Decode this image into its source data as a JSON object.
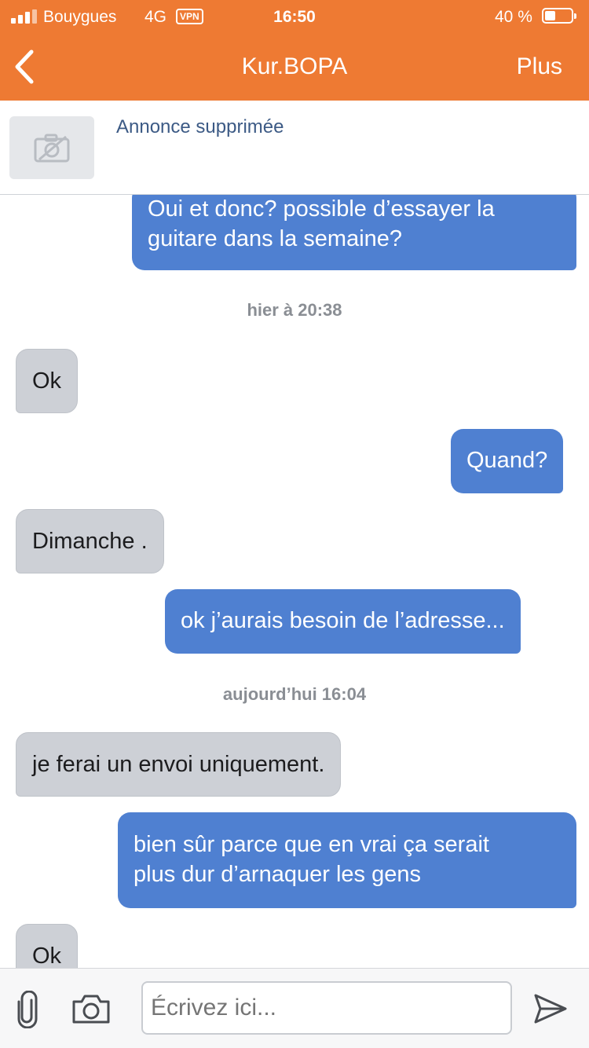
{
  "status_bar": {
    "carrier": "Bouygues",
    "network": "4G",
    "vpn": "VPN",
    "time": "16:50",
    "battery_pct": "40 %",
    "battery_level": 0.4
  },
  "nav": {
    "title": "Kur.BOPA",
    "more": "Plus",
    "accent": "#ee7a33"
  },
  "listing": {
    "title": "Annonce supprimée"
  },
  "messages": [
    {
      "type": "out",
      "text_lines": [
        "Oui et donc? possible d’essayer la",
        "guitare dans la semaine?"
      ]
    },
    {
      "type": "stamp",
      "text": "hier à 20:38"
    },
    {
      "type": "in",
      "text": "Ok"
    },
    {
      "type": "out",
      "text": "Quand?"
    },
    {
      "type": "in",
      "text": "Dimanche ."
    },
    {
      "type": "out",
      "text": "ok j’aurais besoin de l’adresse..."
    },
    {
      "type": "stamp",
      "text": "aujourd’hui 16:04"
    },
    {
      "type": "in",
      "text": "je ferai un envoi uniquement."
    },
    {
      "type": "out",
      "text_lines": [
        "bien sûr parce que en vrai ça serait",
        "plus dur d’arnaquer les gens"
      ]
    },
    {
      "type": "in",
      "text": "Ok"
    }
  ],
  "composer": {
    "placeholder": "Écrivez ici..."
  },
  "colors": {
    "outgoing_bubble": "#4f80d1",
    "incoming_bubble": "#cdd0d6"
  }
}
